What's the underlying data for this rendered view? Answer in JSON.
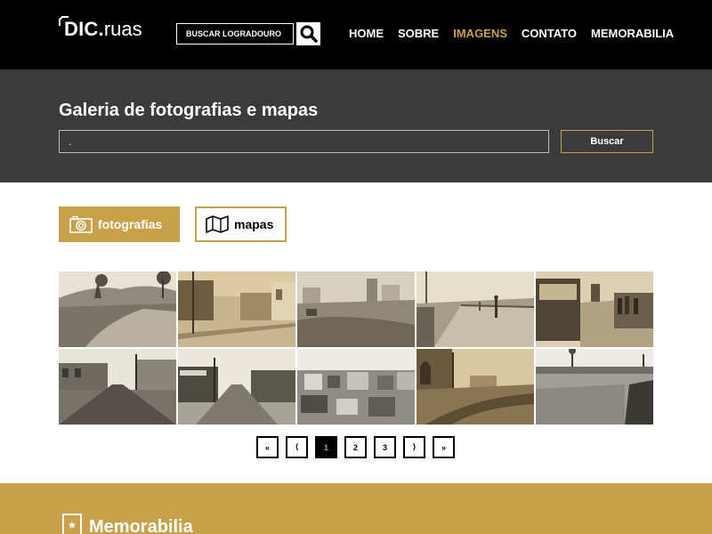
{
  "header": {
    "logo_main": "DIC.",
    "logo_sub": "ruas",
    "search_placeholder": "BUSCAR LOGRADOURO",
    "nav": [
      "HOME",
      "SOBRE",
      "IMAGENS",
      "CONTATO",
      "MEMORABILIA"
    ],
    "active_nav": "IMAGENS"
  },
  "gallery": {
    "title": "Galeria de fotografias e mapas",
    "search_value": ".",
    "search_button": "Buscar",
    "categories": {
      "photos": "fotografias",
      "maps": "mapas"
    }
  },
  "photos": [
    "dirt-road-countryside",
    "street-with-houses",
    "urban-wasteland",
    "bridge-with-people",
    "streetcar-crowd",
    "cobblestone-street",
    "paved-avenue",
    "city-rooftops",
    "muddy-street-construction",
    "gravel-field"
  ],
  "pagination": [
    "«",
    "⟨",
    "1",
    "2",
    "3",
    "⟩",
    "»"
  ],
  "pagination_active": "1",
  "footer": {
    "title": "Memorabilia"
  },
  "colors": {
    "accent": "#c9a14a",
    "topbar": "#000000",
    "band": "#3b3b3b"
  }
}
